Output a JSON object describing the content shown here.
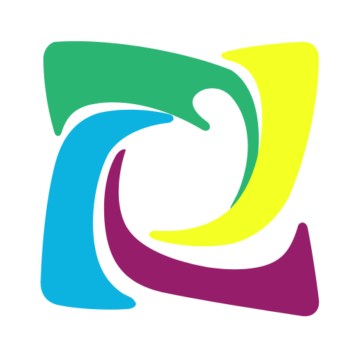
{
  "logo": {
    "background": "#ffffff",
    "blades": [
      {
        "id": "green",
        "color": "#2bb573"
      },
      {
        "id": "yellow",
        "color": "#f4ff24"
      },
      {
        "id": "magenta",
        "color": "#951d6a"
      },
      {
        "id": "blue",
        "color": "#0cb3e0"
      }
    ]
  }
}
